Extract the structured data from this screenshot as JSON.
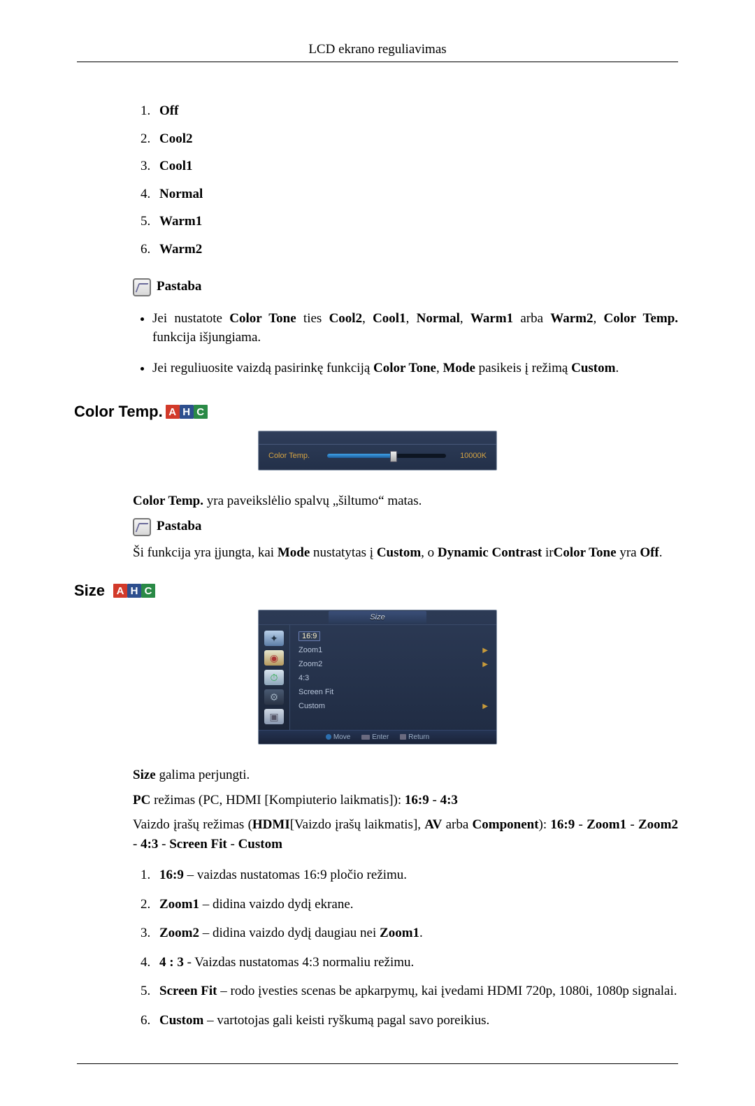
{
  "header": {
    "title": "LCD ekrano reguliavimas"
  },
  "color_tone_list": {
    "items": [
      "Off",
      "Cool2",
      "Cool1",
      "Normal",
      "Warm1",
      "Warm2"
    ]
  },
  "notes": {
    "label": "Pastaba",
    "bullet1_pre": "Jei nustatote ",
    "bullet1_b1": "Color Tone",
    "bullet1_mid1": " ties ",
    "bullet1_b2": "Cool2",
    "bullet1_c1": ", ",
    "bullet1_b3": "Cool1",
    "bullet1_c2": ", ",
    "bullet1_b4": "Normal",
    "bullet1_c3": ", ",
    "bullet1_b5": "Warm1",
    "bullet1_mid2": " arba ",
    "bullet1_b6": "Warm2",
    "bullet1_c4": ", ",
    "bullet1_b7": "Color Temp.",
    "bullet1_tail": " funkcija išjungiama.",
    "bullet2_pre": "Jei reguliuosite vaizdą pasirinkę funkciją ",
    "bullet2_b1": "Color Tone",
    "bullet2_mid1": ", ",
    "bullet2_b2": "Mode",
    "bullet2_mid2": " pasikeis į režimą ",
    "bullet2_b3": "Custom",
    "bullet2_tail": "."
  },
  "color_temp_section": {
    "title": "Color Temp.",
    "tags": {
      "a": "A",
      "h": "H",
      "c": "C"
    },
    "osd": {
      "label": "Color Temp.",
      "value": "10000K"
    },
    "desc_b": "Color Temp.",
    "desc_tail": " yra paveikslėlio spalvų „šiltumo“ matas.",
    "note_pre": "Ši funkcija yra įjungta, kai ",
    "note_b1": "Mode",
    "note_mid1": " nustatytas į ",
    "note_b2": "Custom",
    "note_mid2": ", o ",
    "note_b3": "Dynamic Contrast",
    "note_mid3": " ir",
    "note_b4": "Color Tone",
    "note_mid4": " yra ",
    "note_b5": "Off",
    "note_tail": "."
  },
  "size_section": {
    "title": "Size",
    "tags": {
      "a": "A",
      "h": "H",
      "c": "C"
    },
    "osd": {
      "header": "Size",
      "items": [
        {
          "label": "16:9",
          "selected": true,
          "arrow": false
        },
        {
          "label": "Zoom1",
          "selected": false,
          "arrow": true
        },
        {
          "label": "Zoom2",
          "selected": false,
          "arrow": true
        },
        {
          "label": "4:3",
          "selected": false,
          "arrow": false
        },
        {
          "label": "Screen Fit",
          "selected": false,
          "arrow": false
        },
        {
          "label": "Custom",
          "selected": false,
          "arrow": true
        }
      ],
      "footer": {
        "move": "Move",
        "enter": "Enter",
        "return": "Return"
      }
    },
    "p1_b": "Size",
    "p1_tail": " galima perjungti.",
    "p2_b1": "PC",
    "p2_mid": " režimas (PC, HDMI [Kompiuterio laikmatis]): ",
    "p2_b2": "16:9",
    "p2_dash": " - ",
    "p2_b3": "4:3",
    "p3_pre": "Vaizdo įrašų režimas (",
    "p3_b1": "HDMI",
    "p3_mid1": "[Vaizdo įrašų laikmatis], ",
    "p3_b2": "AV",
    "p3_mid2": " arba ",
    "p3_b3": "Component",
    "p3_mid3": "): ",
    "p3_b4": "16:9",
    "p3_d1": " - ",
    "p3_b5": "Zoom1",
    "p3_d2": " - ",
    "p3_b6": "Zoom2",
    "p3_d3": " - ",
    "p3_b7": "4:3",
    "p3_d4": " - ",
    "p3_b8": "Screen Fit",
    "p3_d5": " - ",
    "p3_b9": "Custom",
    "size_items": [
      {
        "name": "16:9",
        "desc": " – vaizdas nustatomas 16:9 pločio režimu."
      },
      {
        "name": "Zoom1",
        "desc": " – didina vaizdo dydį ekrane."
      },
      {
        "name": "Zoom2",
        "desc_pre": " – didina vaizdo dydį daugiau nei ",
        "desc_b": "Zoom1",
        "desc_post": "."
      },
      {
        "name": "4 : 3",
        "desc": " - Vaizdas nustatomas 4:3 normaliu režimu."
      },
      {
        "name": "Screen Fit",
        "desc": " – rodo įvesties scenas be apkarpymų, kai įvedami HDMI 720p, 1080i, 1080p signalai."
      },
      {
        "name": "Custom",
        "desc": " – vartotojas gali keisti ryškumą pagal savo poreikius."
      }
    ]
  }
}
